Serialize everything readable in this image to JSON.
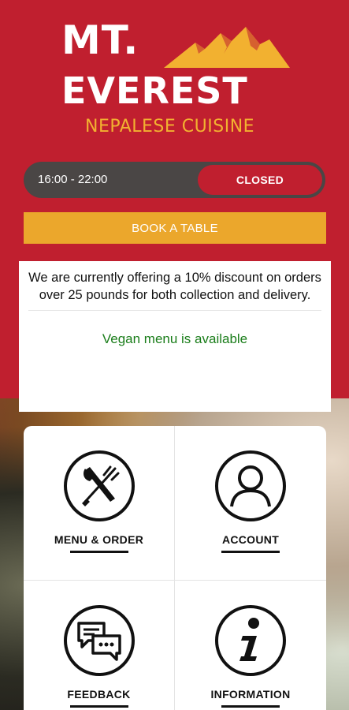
{
  "brand": {
    "line1": "MT.",
    "line2": "EVEREST",
    "tagline": "NEPALESE CUISINE"
  },
  "hours": {
    "range": "16:00 - 22:00",
    "status": "CLOSED"
  },
  "book_button": "BOOK A TABLE",
  "notice": {
    "message": "We are currently offering a 10% discount on orders over 25 pounds for both collection and delivery.",
    "vegan": "Vegan menu is available"
  },
  "tiles": [
    {
      "label": "MENU & ORDER",
      "icon": "cutlery-icon"
    },
    {
      "label": "ACCOUNT",
      "icon": "user-icon"
    },
    {
      "label": "FEEDBACK",
      "icon": "chat-bubbles-icon"
    },
    {
      "label": "INFORMATION",
      "icon": "info-icon"
    }
  ],
  "colors": {
    "background": "#c01f2f",
    "accent_gold": "#eba72c",
    "status_closed": "#c01f2f",
    "vegan_green": "#1a7d1a"
  }
}
